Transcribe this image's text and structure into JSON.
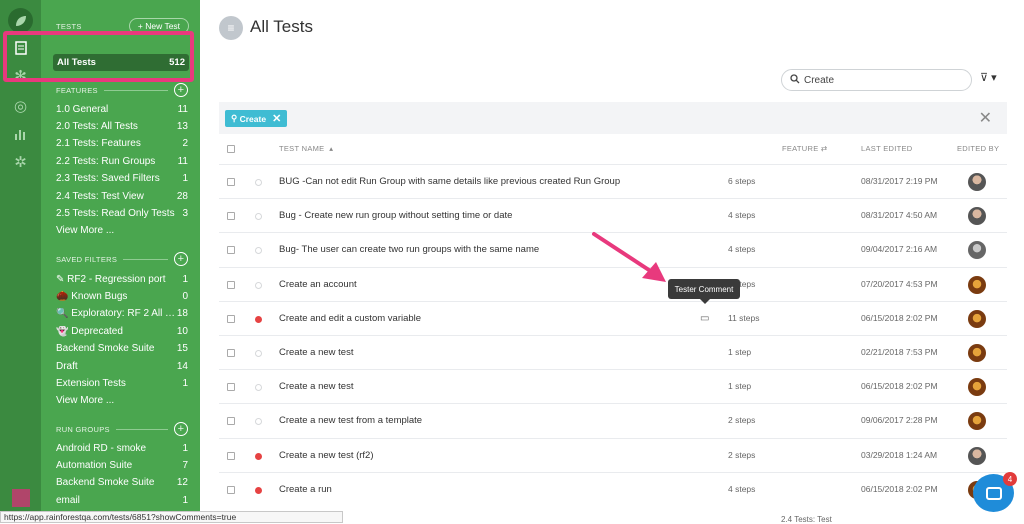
{
  "sidebar": {
    "tests_label": "TESTS",
    "new_test": "+ New Test",
    "all_tests": {
      "label": "All Tests",
      "count": "512"
    },
    "features_label": "FEATURES",
    "features": [
      {
        "label": "1.0 General",
        "count": "11"
      },
      {
        "label": "2.0 Tests: All Tests",
        "count": "13"
      },
      {
        "label": "2.1 Tests: Features",
        "count": "2"
      },
      {
        "label": "2.2 Tests: Run Groups",
        "count": "11"
      },
      {
        "label": "2.3 Tests: Saved Filters",
        "count": "1"
      },
      {
        "label": "2.4 Tests: Test View",
        "count": "28"
      },
      {
        "label": "2.5 Tests: Read Only Tests",
        "count": "3"
      },
      {
        "label": "View More ...",
        "count": ""
      }
    ],
    "saved_filters_label": "SAVED FILTERS",
    "saved_filters": [
      {
        "label": "✎ RF2 - Regression port",
        "count": "1"
      },
      {
        "label": "🌰 Known Bugs",
        "count": "0"
      },
      {
        "label": "🔍 Exploratory: RF 2 All T...",
        "count": "18"
      },
      {
        "label": "👻 Deprecated",
        "count": "10"
      },
      {
        "label": "Backend Smoke Suite",
        "count": "15"
      },
      {
        "label": "Draft",
        "count": "14"
      },
      {
        "label": "Extension Tests",
        "count": "1"
      },
      {
        "label": "View More ...",
        "count": ""
      }
    ],
    "run_groups_label": "RUN GROUPS",
    "run_groups": [
      {
        "label": "Android RD - smoke",
        "count": "1"
      },
      {
        "label": "Automation Suite",
        "count": "7"
      },
      {
        "label": "Backend Smoke Suite",
        "count": "12"
      },
      {
        "label": "email",
        "count": "1"
      }
    ]
  },
  "header": {
    "title": "All Tests"
  },
  "search": {
    "value": "Create"
  },
  "filter_chip": {
    "label": "Create"
  },
  "table": {
    "columns": {
      "name": "TEST NAME",
      "feature": "FEATURE",
      "last_edited": "LAST EDITED",
      "edited_by": "EDITED BY"
    },
    "rows": [
      {
        "name": "BUG -Can not edit Run Group with same details like previous created Run Group",
        "steps": "6 steps",
        "edited": "08/31/2017 2:19 PM",
        "red": false,
        "avatar": "g"
      },
      {
        "name": "Bug - Create new run group without setting time or date",
        "steps": "4 steps",
        "edited": "08/31/2017 4:50 AM",
        "red": false,
        "avatar": "g"
      },
      {
        "name": "Bug- The user can create two run groups with the same name",
        "steps": "4 steps",
        "edited": "09/04/2017 2:16 AM",
        "red": false,
        "avatar": "d"
      },
      {
        "name": "Create an account",
        "steps": "6 steps",
        "edited": "07/20/2017 4:53 PM",
        "red": false,
        "avatar": "o"
      },
      {
        "name": "Create and edit a custom variable",
        "steps": "11 steps",
        "edited": "06/15/2018 2:02 PM",
        "red": true,
        "avatar": "o"
      },
      {
        "name": "Create a new test",
        "steps": "1 step",
        "edited": "02/21/2018 7:53 PM",
        "red": false,
        "avatar": "o"
      },
      {
        "name": "Create a new test",
        "steps": "1 step",
        "edited": "06/15/2018 2:02 PM",
        "red": false,
        "avatar": "o"
      },
      {
        "name": "Create a new test from a template",
        "steps": "2 steps",
        "edited": "09/06/2017 2:28 PM",
        "red": false,
        "avatar": "o"
      },
      {
        "name": "Create a new test (rf2)",
        "steps": "2 steps",
        "edited": "03/29/2018 1:24 AM",
        "red": true,
        "avatar": "g"
      },
      {
        "name": "Create a run",
        "steps": "4 steps",
        "edited": "06/15/2018 2:02 PM",
        "red": true,
        "avatar": "o"
      }
    ]
  },
  "tooltip": "Tester Comment",
  "status_url": "https://app.rainforestqa.com/tests/6851?showComments=true",
  "footer_text": "2.4 Tests: Test",
  "chat_badge": "4",
  "colors": {
    "sidebar": "#4aa64f",
    "rail": "#3b8a40",
    "highlight": "#e8397d",
    "chip": "#3fbcd3",
    "red_dot": "#e64343"
  }
}
